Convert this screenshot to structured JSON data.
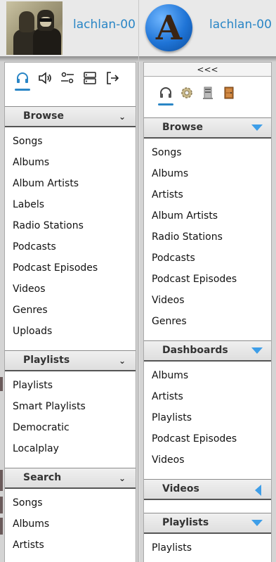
{
  "left": {
    "username": "lachlan-00",
    "sections": [
      {
        "title": "Browse",
        "items": [
          "Songs",
          "Albums",
          "Album Artists",
          "Labels",
          "Radio Stations",
          "Podcasts",
          "Podcast Episodes",
          "Videos",
          "Genres",
          "Uploads"
        ]
      },
      {
        "title": "Playlists",
        "items": [
          "Playlists",
          "Smart Playlists",
          "Democratic",
          "Localplay"
        ]
      },
      {
        "title": "Search",
        "items": [
          "Songs",
          "Albums",
          "Artists"
        ]
      }
    ]
  },
  "right": {
    "username": "lachlan-00",
    "logo_letter": "A",
    "collapse_label": "<<<",
    "sections": [
      {
        "title": "Browse",
        "items": [
          "Songs",
          "Albums",
          "Artists",
          "Album Artists",
          "Radio Stations",
          "Podcasts",
          "Podcast Episodes",
          "Videos",
          "Genres"
        ]
      },
      {
        "title": "Dashboards",
        "items": [
          "Albums",
          "Artists",
          "Playlists",
          "Podcast Episodes",
          "Videos"
        ]
      },
      {
        "title": "Videos",
        "items": []
      },
      {
        "title": "Playlists",
        "items": [
          "Playlists"
        ]
      }
    ]
  },
  "colors": {
    "accent": "#2a86c6",
    "triangle": "#3e9ee8"
  }
}
